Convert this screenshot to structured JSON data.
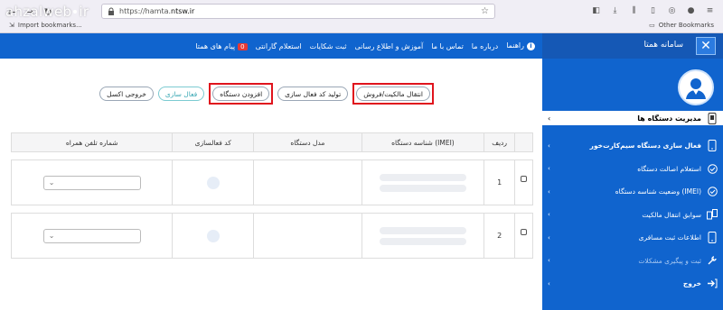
{
  "browser": {
    "url_prefix": "https://hamta.",
    "url_domain": "ntsw.ir",
    "bookmarks_left": "Import bookmarks...",
    "bookmarks_right": "Other Bookmarks"
  },
  "watermark": {
    "text_left": "ahzalweb",
    "text_right": "ir"
  },
  "header": {
    "brand": "سامانه همتا",
    "close_label": "✕",
    "menu": [
      {
        "label": "پیام های همتا",
        "badge": "0"
      },
      {
        "label": "استعلام گارانتی"
      },
      {
        "label": "ثبت شکایات"
      },
      {
        "label": "آموزش و اطلاع رسانی"
      },
      {
        "label": "تماس با ما"
      },
      {
        "label": "درباره ما"
      },
      {
        "label": "راهنما"
      }
    ]
  },
  "actions": {
    "transfer": "انتقال مالکیت/فروش",
    "generate_code": "تولید کد فعال سازی",
    "add_device": "افزودن دستگاه",
    "activate": "فعال سازی",
    "export_excel": "خروجی اکسل"
  },
  "table": {
    "headers": {
      "index": "ردیف",
      "imei": "شناسه دستگاه (IMEI)",
      "model": "مدل دستگاه",
      "code": "کد فعالسازی",
      "phone": "شماره تلفن همراه"
    },
    "rows": [
      {
        "index": "1"
      },
      {
        "index": "2"
      }
    ]
  },
  "sidebar": {
    "header": "مدیریت دستگاه ها",
    "items": [
      {
        "label": "فعال سازی دستگاه سیم‌کارت‌خور",
        "icon": "phone-icon"
      },
      {
        "label": "استعلام اصالت دستگاه",
        "icon": "check-icon"
      },
      {
        "label": "وضعیت شناسه دستگاه (IMEI)",
        "icon": "check-icon"
      },
      {
        "label": "سوابق انتقال مالکیت",
        "icon": "transfer-icon"
      },
      {
        "label": "اطلاعات ثبت مسافری",
        "icon": "phone-icon"
      },
      {
        "label": "ثبت و پیگیری مشکلات",
        "icon": "tools-icon"
      },
      {
        "label": "خروج",
        "icon": "logout-icon"
      }
    ]
  },
  "colors": {
    "primary": "#1064ce",
    "highlight": "#e0141d",
    "teal": "#3aa8b4"
  }
}
